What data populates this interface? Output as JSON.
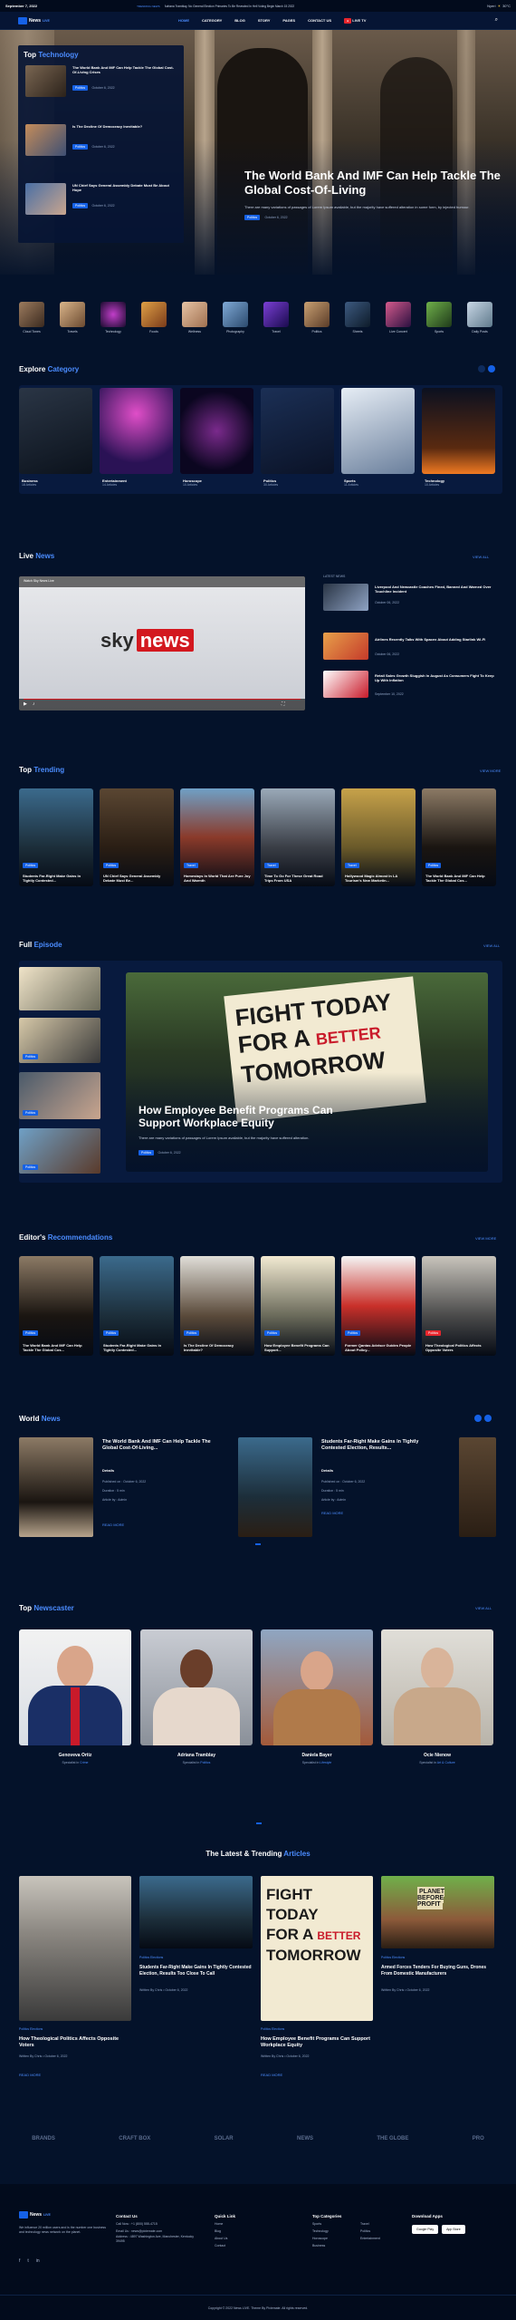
{
  "topbar": {
    "date": "September 7, 2022",
    "ticker_label": "TRENDING NEWS",
    "ticker": "Adriana Tramblay, No General Election Primaries To Be Revealed In Hell Voting Begin March 15 2022",
    "location": "Nyeri",
    "temp": "30°C"
  },
  "nav": {
    "logo": "News",
    "logo_suffix": "LIVE",
    "items": [
      "HOME",
      "CATEGORY",
      "BLOG",
      "STORY",
      "PAGES",
      "CONTACT US"
    ],
    "live": "LIVE TV"
  },
  "hero": {
    "title": "The World Bank And IMF Can Help Tackle The Global Cost-Of-Living",
    "desc": "There are many variations of passages of Lorem Ipsum available, but the majority have suffered alteration in some form, by injected humour.",
    "tag": "Politics",
    "date": "October 6, 2022"
  },
  "top_tech": {
    "title_a": "Top",
    "title_b": "Technology",
    "items": [
      {
        "title": "The World Bank And IMF Can Help Tackle The Global Cost-Of-Living Crises",
        "tag": "Politics",
        "date": "October 6, 2022"
      },
      {
        "title": "Is The Decline Of Democracy Inevitable?",
        "tag": "Politics",
        "date": "October 6, 2022"
      },
      {
        "title": "UN Chief Says General Assembly Debate Must Be About Hope",
        "tag": "Politics",
        "date": "October 6, 2022"
      }
    ]
  },
  "categories": [
    "Cloud Tones",
    "Travels",
    "Technology",
    "Foods",
    "Wellness",
    "Photography",
    "Travel",
    "Politics",
    "Sheets",
    "Live Concert",
    "Sports",
    "Daily Posts"
  ],
  "explore": {
    "title_a": "Explore",
    "title_b": "Category",
    "items": [
      {
        "name": "Business",
        "count": "18 Articles"
      },
      {
        "name": "Entertainment",
        "count": "14 Articles"
      },
      {
        "name": "Horoscope",
        "count": "10 Articles"
      },
      {
        "name": "Politics",
        "count": "30 Articles"
      },
      {
        "name": "Sports",
        "count": "11 Articles"
      },
      {
        "name": "Technology",
        "count": "10 Articles"
      }
    ]
  },
  "live_news": {
    "title_a": "Live",
    "title_b": "News",
    "more": "VIEW ALL",
    "video_title": "Watch Sky News Live",
    "brand_a": "sky",
    "brand_b": "news",
    "side_head": "LATEST NEWS",
    "side": [
      {
        "title": "Liverpool And Newcastle Coaches Fined, Banned And Warned Over Touchline Incident",
        "date": "October 06, 2022"
      },
      {
        "title": "Airlines Recently Talks With Spacex About Adding Starlink Wi-Fi",
        "date": "October 06, 2022"
      },
      {
        "title": "Retail Sales Growth Sluggish In August As Consumers Fight To Keep Up With Inflation",
        "date": "September 10, 2022"
      }
    ]
  },
  "top_trending": {
    "title_a": "Top",
    "title_b": "Trending",
    "more": "VIEW MORE",
    "items": [
      {
        "title": "Students Far-Right Make Gains In Tightly Contested...",
        "tag": "Politics"
      },
      {
        "title": "UN Chief Says General Assembly Debate Must Be...",
        "tag": "Politics"
      },
      {
        "title": "Homestays In World That Are Pure Joy And Warmth",
        "tag": "Travel"
      },
      {
        "title": "Time To Go For These Great Road Trips From USA",
        "tag": "Travel"
      },
      {
        "title": "Hollywood Magic Almost In LA Tourism's New Marketin...",
        "tag": "Travel"
      },
      {
        "title": "The World Bank And IMF Can Help Tackle The Global Cos...",
        "tag": "Politics"
      }
    ]
  },
  "full_episode": {
    "title_a": "Full",
    "title_b": "Episode",
    "more": "VIEW ALL",
    "main_title": "How Employee Benefit Programs Can Support Workplace Equity",
    "main_desc": "There are many variations of passages of Lorem Ipsum available, but the majority have suffered alteration.",
    "tag": "Politics",
    "date": "October 6, 2022",
    "thumb_tags": [
      "Politics",
      "Politics",
      "Politics",
      "Politics"
    ],
    "sign_a": "FIGHT TODAY",
    "sign_b": "FOR A",
    "sign_c": "BETTER",
    "sign_d": "TOMORROW"
  },
  "editors": {
    "title_a": "Editor's",
    "title_b": "Recommendations",
    "more": "VIEW MORE",
    "items": [
      {
        "title": "The World Bank And IMF Can Help Tackle The Global Cos...",
        "tag": "Politics"
      },
      {
        "title": "Students Far-Right Make Gains In Tightly Contested...",
        "tag": "Politics"
      },
      {
        "title": "Is The Decline Of Democracy Inevitable?",
        "tag": "Politics"
      },
      {
        "title": "How Employee Benefit Programs Can Support...",
        "tag": "Politics"
      },
      {
        "title": "Former Qantas Advisor Guides People About Policy...",
        "tag": "Politics"
      },
      {
        "title": "How Theological Politics Affects Opposite Voters",
        "tag": "Politics"
      }
    ]
  },
  "world_news": {
    "title_a": "World",
    "title_b": "News",
    "items": [
      {
        "title": "The World Bank And IMF Can Help Tackle The Global Cost-Of-Living...",
        "details": "Details",
        "published": "Published on : October 6, 2022",
        "duration": "Duration : 5 min",
        "author": "Article by : Admin",
        "more": "READ MORE"
      },
      {
        "title": "Students Far-Right Make Gains In Tightly Contested Election, Results...",
        "details": "Details",
        "published": "Published on : October 6, 2022",
        "duration": "Duration : 5 min",
        "author": "Article by : Admin",
        "more": "READ MORE"
      }
    ]
  },
  "newscasters": {
    "title_a": "Top",
    "title_b": "Newscaster",
    "more": "VIEW ALL",
    "people": [
      {
        "name": "Genoveva Ortiz",
        "role_a": "Specialist in",
        "role_b": "Crime"
      },
      {
        "name": "Adriana Tramblay",
        "role_a": "Specialist in",
        "role_b": "Politics"
      },
      {
        "name": "Daniela Bayer",
        "role_a": "Specialist in",
        "role_b": "Lifestyle"
      },
      {
        "name": "Ocie Nienow",
        "role_a": "Specialist in",
        "role_b": "Art & Culture"
      }
    ]
  },
  "latest": {
    "title_a": "The Latest & Trending",
    "title_b": "Articles",
    "big": [
      {
        "tags": "Politics  Elections",
        "title": "How Theological Politics Affects Opposite Voters",
        "by": "Written By Chris  •  October 6, 2022",
        "more": "READ MORE"
      },
      {
        "tags": "Politics  Elections",
        "title": "How Employee Benefit Programs Can Support Workplace Equity",
        "by": "Written By Chris  •  October 6, 2022",
        "more": "READ MORE"
      }
    ],
    "small": [
      {
        "tags": "Politics  Elections",
        "title": "Students Far-Right Make Gains In Tightly Contested Election, Results Too Close To Call",
        "by": "Written By Chris  •  October 6, 2022"
      },
      {
        "tags": "Politics  Elections",
        "title": "Armed Forces Tenders For Buying Guns, Drones From Domestic Manufacturers",
        "by": "Written By Chris  •  October 6, 2022"
      }
    ],
    "sign": "PLANET BEFORE PROFIT"
  },
  "brands": [
    "BRANDS",
    "CRAFT BOX",
    "SOLAR",
    "NEWS",
    "THE GLOBE",
    "PRO"
  ],
  "footer": {
    "about": "We influence 20 million users and is the number one business and technology news network on the planet.",
    "contact_h": "Contact Us",
    "contact": [
      "Call Now : +1 (800) 555-4715",
      "Email Us : news@pixiemate.com",
      "Address : 4897 Washington Ave, Manchester, Kentucky 39495"
    ],
    "quick_h": "Quick Link",
    "quick": [
      "Home",
      "Blog",
      "About Us",
      "Contact"
    ],
    "cats_h": "Top Categories",
    "cats_a": [
      "Sports",
      "Technology",
      "Horoscope",
      "Business"
    ],
    "cats_b": [
      "Travel",
      "Politics",
      "Entertainment"
    ],
    "app_h": "Download Apps",
    "app_a": "Google Play",
    "app_b": "App Store",
    "copyright": "Copyright © 2022 News LIVE. Theme By Pixiemate. All rights reserved."
  },
  "colors": {
    "bg": "#04122a",
    "accent": "#1561e6",
    "live": "#e8262d"
  }
}
